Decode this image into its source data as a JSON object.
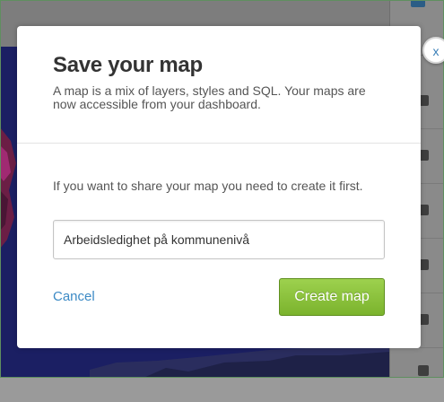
{
  "modal": {
    "title": "Save your map",
    "description": "A map is a mix of layers, styles and SQL. Your maps are now accessible from your dashboard.",
    "share_text": "If you want to share your map you need to create it first.",
    "map_name_value": "Arbeidsledighet på kommunenivå",
    "cancel_label": "Cancel",
    "create_label": "Create map",
    "close_label": "x"
  },
  "colors": {
    "accent_link": "#3c8ac5",
    "create_button": "#8dc33f",
    "map_background": "#1b1f63",
    "choropleth_dark": "#5a1a3a",
    "choropleth_mid": "#9a2a6a"
  },
  "background_panel": {
    "icons": [
      "layers-icon",
      "sql-icon",
      "style-icon",
      "infowindow-icon",
      "legend-icon",
      "filter-icon",
      "histogram-icon"
    ]
  }
}
